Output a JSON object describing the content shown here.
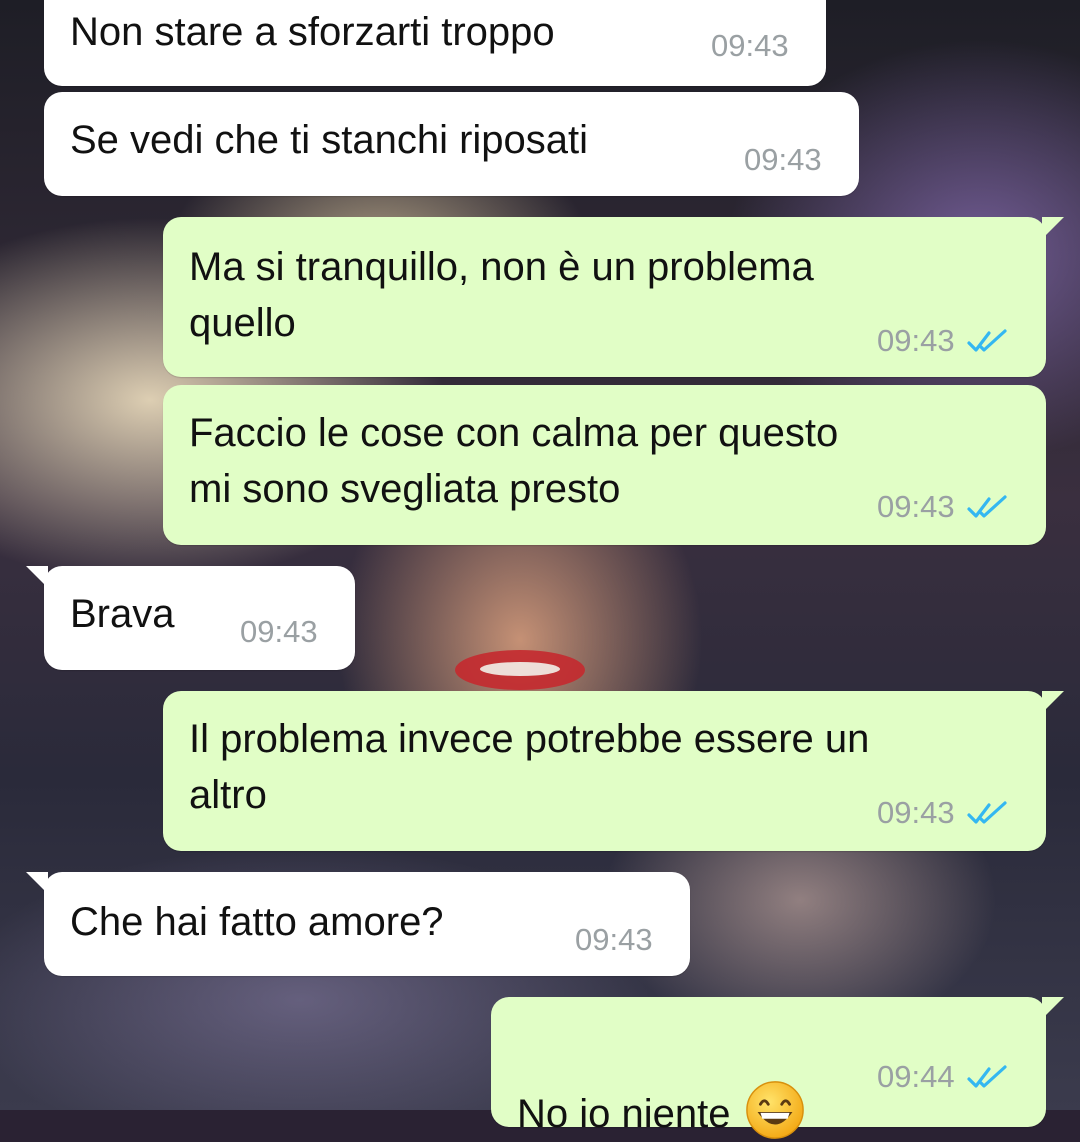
{
  "colors": {
    "incoming_bubble": "#ffffff",
    "outgoing_bubble": "#e1fec6",
    "time": "#9aa0a3",
    "read_ticks": "#34b7f1"
  },
  "messages": [
    {
      "direction": "in",
      "text": "Non stare a sforzarti troppo",
      "time": "09:43"
    },
    {
      "direction": "in",
      "text": "Se vedi che ti stanchi riposati",
      "time": "09:43"
    },
    {
      "direction": "out",
      "text": "Ma si tranquillo, non è un problema\nquello",
      "time": "09:43",
      "status_icon": "double-check-read-icon"
    },
    {
      "direction": "out",
      "text": "Faccio le cose con calma per questo\nmi sono svegliata presto",
      "time": "09:43",
      "status_icon": "double-check-read-icon"
    },
    {
      "direction": "in",
      "text": "Brava",
      "time": "09:43"
    },
    {
      "direction": "out",
      "text": "Il problema invece potrebbe essere un\naltro",
      "time": "09:43",
      "status_icon": "double-check-read-icon"
    },
    {
      "direction": "in",
      "text": "Che hai fatto amore?",
      "time": "09:43"
    },
    {
      "direction": "out",
      "text": "No io niente",
      "emoji": "grinning-face-with-smiling-eyes",
      "time": "09:44",
      "status_icon": "double-check-read-icon"
    }
  ]
}
